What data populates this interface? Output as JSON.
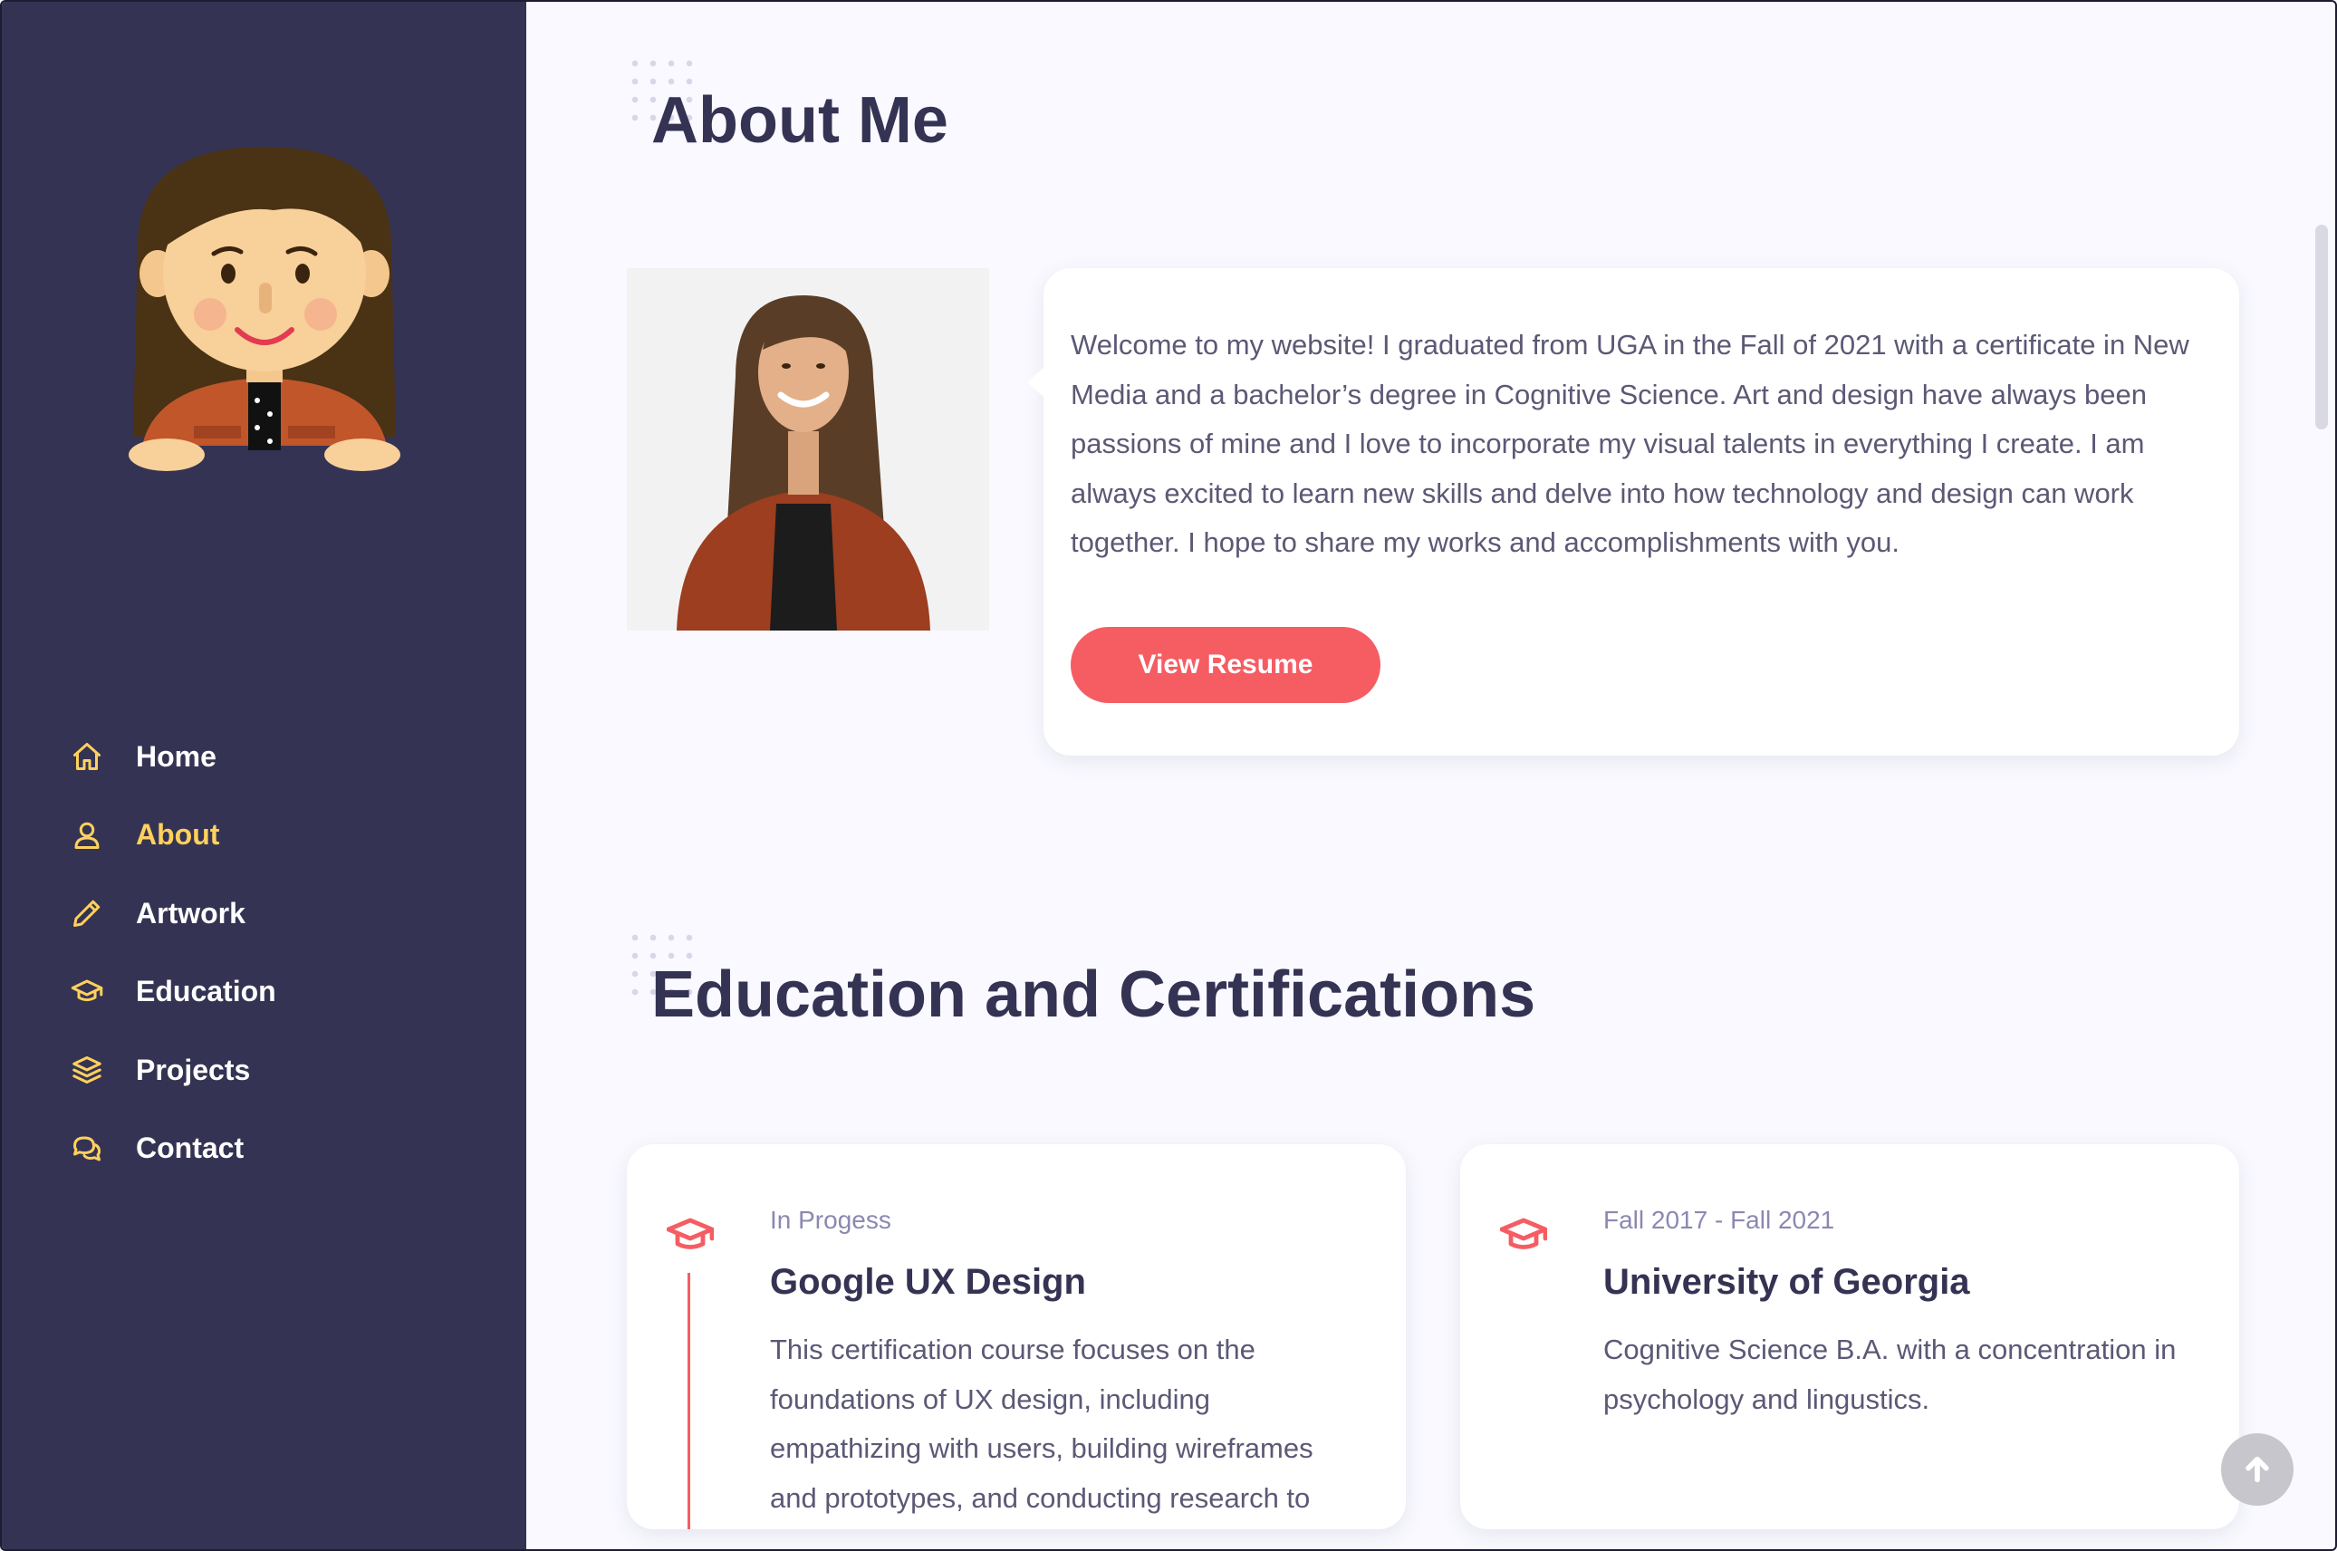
{
  "sidebar": {
    "avatar_alt": "",
    "items": [
      {
        "label": "Home",
        "icon": "home-icon"
      },
      {
        "label": "About",
        "icon": "user-icon",
        "active": true
      },
      {
        "label": "Artwork",
        "icon": "pencil-icon"
      },
      {
        "label": "Education",
        "icon": "graduation-cap-icon"
      },
      {
        "label": "Projects",
        "icon": "layers-icon"
      },
      {
        "label": "Contact",
        "icon": "chat-bubbles-icon"
      }
    ]
  },
  "about": {
    "title": "About Me",
    "text": "Welcome to my website! I graduated from UGA in the Fall of 2021 with a certificate in New Media and a bachelor’s degree in Cognitive Science. Art and design have always been passions of mine and I love to incorporate my visual talents in everything I create. I am always excited to learn new skills and delve into how technology and design can work together. I hope to share my works and accomplishments with you.",
    "button_label": "View Resume"
  },
  "education": {
    "title": "Education and Certifications",
    "cards": [
      {
        "date": "In Progess",
        "title": "Google UX Design",
        "description": "This certification course focuses on the foundations of UX design, including empathizing with users, building wireframes and prototypes, and conducting research to test designs."
      },
      {
        "date": "Fall 2017 - Fall 2021",
        "title": "University of Georgia",
        "description": "Cognitive Science B.A. with a concentration in psychology and lingustics."
      }
    ]
  },
  "colors": {
    "sidebar_bg": "#353353",
    "accent_yellow": "#ffd15c",
    "accent_red": "#f55d63",
    "page_bg": "#f9f9ff"
  }
}
